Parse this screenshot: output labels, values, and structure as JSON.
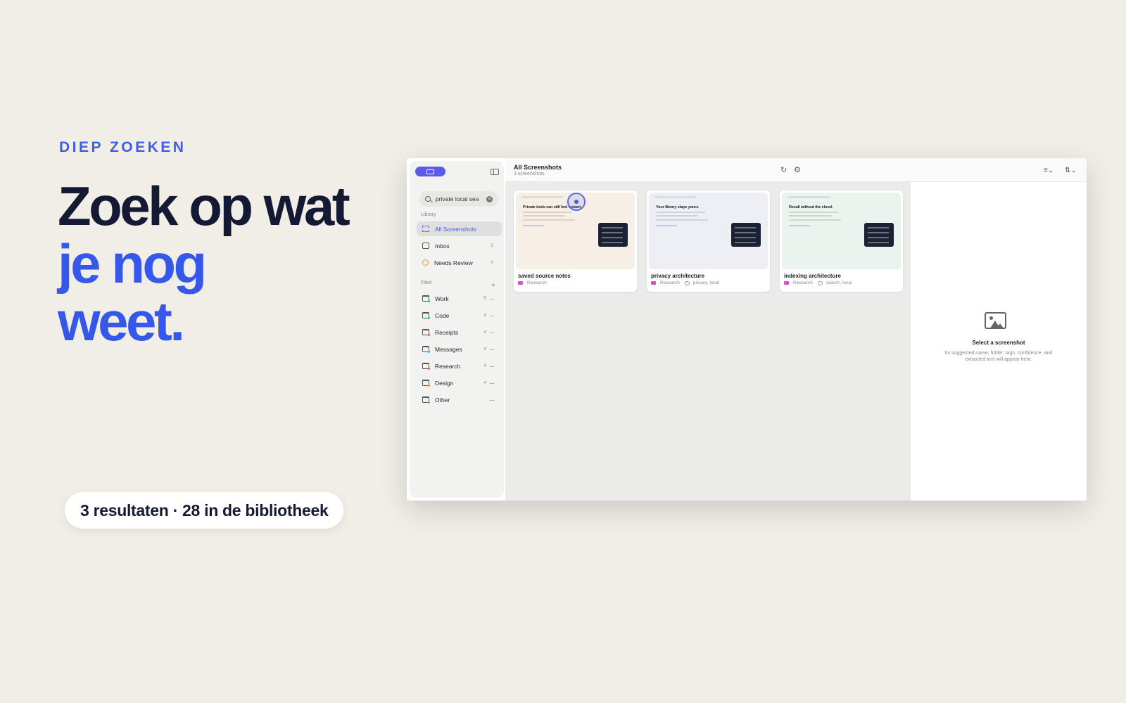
{
  "promo": {
    "eyebrow": "DIEP ZOEKEN",
    "headline_line1": "Zoek op wat",
    "headline_line2": "je nog",
    "headline_line3": "weet.",
    "result_pill": "3 resultaten · 28 in de bibliotheek"
  },
  "colors": {
    "accent": "#3558ea",
    "dark": "#141a33",
    "background": "#f1eee7",
    "brand_button": "#5a5ce8"
  },
  "sidebar": {
    "search_value": "private local sea",
    "library_label": "Library",
    "library_items": [
      {
        "label": "All Screenshots",
        "count": "",
        "icon": "grid-icon"
      },
      {
        "label": "Inbox",
        "count": "3",
        "icon": "inbox-icon"
      },
      {
        "label": "Needs Review",
        "count": "8",
        "icon": "review-icon"
      }
    ],
    "filed_label": "Filed",
    "add_label": "+",
    "folders": [
      {
        "label": "Work",
        "count": "5",
        "dot": "#3cc06a"
      },
      {
        "label": "Code",
        "count": "4",
        "dot": "#3cc06a"
      },
      {
        "label": "Receipts",
        "count": "4",
        "dot": "#e84a6a"
      },
      {
        "label": "Messages",
        "count": "4",
        "dot": "#3ca0e8"
      },
      {
        "label": "Research",
        "count": "4",
        "dot": "#d34bd6"
      },
      {
        "label": "Design",
        "count": "4",
        "dot": "#e8953a"
      },
      {
        "label": "Other",
        "count": "",
        "dot": "#999999"
      }
    ],
    "more_label": "···"
  },
  "toolbar": {
    "title": "All Screenshots",
    "subtitle": "3 screenshots",
    "refresh_icon": "↻",
    "settings_icon": "⚙",
    "filter_icon": "≡⌄",
    "sort_icon": "⇅⌄"
  },
  "cards": [
    {
      "title": "saved source notes",
      "folder": "Research",
      "tags": "",
      "thumb_heading": "Private tools can still feel instant.",
      "thumb_bg": "#f6efe6"
    },
    {
      "title": "privacy architecture",
      "folder": "Research",
      "tags": "privacy, local",
      "thumb_heading": "Your library stays yours.",
      "thumb_bg": "#eeeff5"
    },
    {
      "title": "indexing architecture",
      "folder": "Research",
      "tags": "search, local",
      "thumb_heading": "Recall without the cloud.",
      "thumb_bg": "#eaf3ee"
    }
  ],
  "detail": {
    "title": "Select a screenshot",
    "description": "Its suggested name, folder, tags, confidence, and extracted text will appear here."
  }
}
